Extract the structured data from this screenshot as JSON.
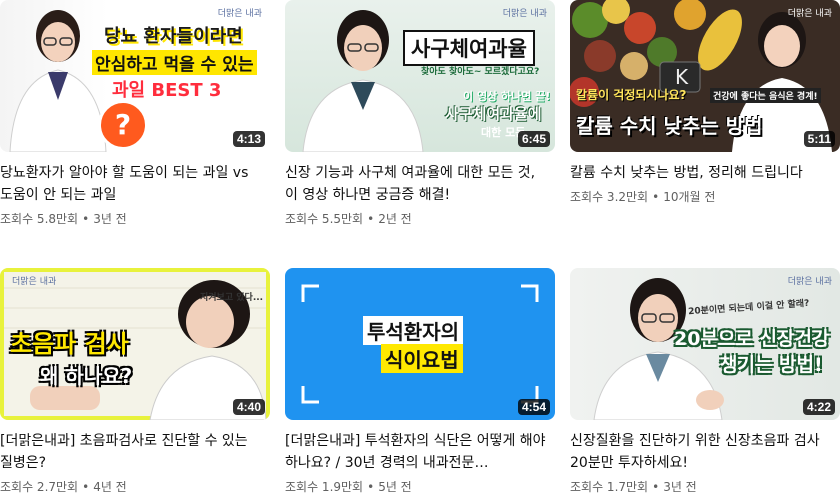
{
  "videos": [
    {
      "duration": "4:13",
      "title": "당뇨환자가 알아야 할 도움이 되는 과일 vs 도움이 안 되는 과일",
      "views": "조회수 5.8만회",
      "age": "3년 전",
      "brand": "더맑은 내과",
      "overlay": [
        "당뇨 환자들이라면",
        "안심하고 먹을 수 있는",
        "과일 BEST 3"
      ]
    },
    {
      "duration": "6:45",
      "title": "신장 기능과 사구체 여과율에 대한 모든 것, 이 영상 하나면 궁금증 해결!",
      "views": "조회수 5.5만회",
      "age": "2년 전",
      "brand": "더맑은 내과",
      "overlay": [
        "사구체여과율",
        "찾아도 찾아도~ 모르겠다고요?",
        "이 영상 하나면 끝!",
        "사구체여과율에",
        "대한 모든"
      ]
    },
    {
      "duration": "5:11",
      "title": "칼륨 수치 낮추는 방법, 정리해 드립니다",
      "views": "조회수 3.2만회",
      "age": "10개월 전",
      "brand": "더맑은 내과",
      "overlay": [
        "칼륨이 걱정되시나요?",
        "건강에 좋다는 음식은 경계!",
        "칼륨 수치 낮추는 방법"
      ]
    },
    {
      "duration": "4:40",
      "title": "[더맑은내과] 초음파검사로 진단할 수 있는 질병은?",
      "views": "조회수 2.7만회",
      "age": "4년 전",
      "brand": "더맑은 내과",
      "overlay": [
        "지켜보고 있다...",
        "초음파 검사",
        "왜 하나요?"
      ]
    },
    {
      "duration": "4:54",
      "title": "[더맑은내과] 투석환자의 식단은 어떻게 해야 하나요? / 30년 경력의 내과전문…",
      "views": "조회수 1.9만회",
      "age": "5년 전",
      "brand": "",
      "overlay": [
        "투석환자의",
        "식이요법"
      ]
    },
    {
      "duration": "4:22",
      "title": "신장질환을 진단하기 위한 신장초음파 검사 20분만 투자하세요!",
      "views": "조회수 1.7만회",
      "age": "3년 전",
      "brand": "더맑은 내과",
      "overlay": [
        "20분이면 되는데 이걸 안 할래?",
        "20분으로 신장건강",
        "챙기는 방법!"
      ]
    }
  ],
  "separator": "•"
}
